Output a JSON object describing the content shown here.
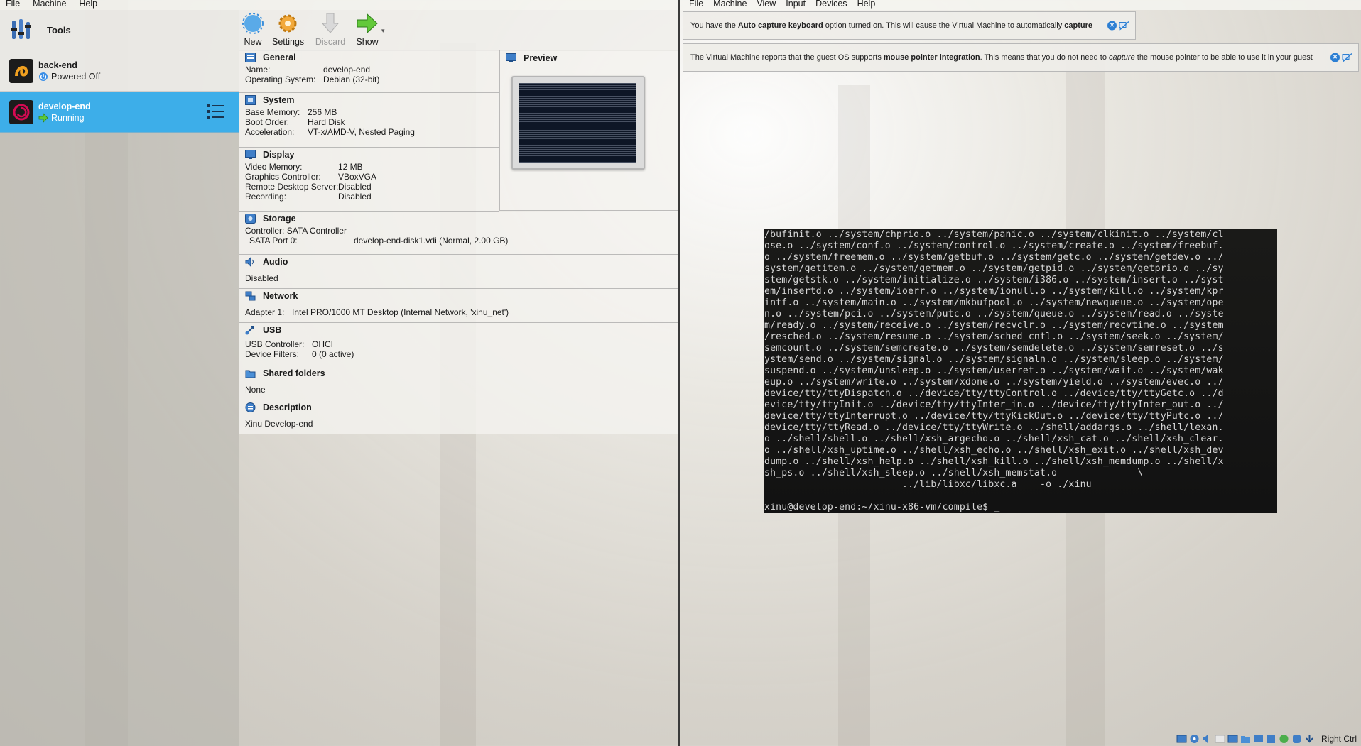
{
  "manager": {
    "menu": [
      "File",
      "Machine",
      "Help"
    ],
    "tools_label": "Tools",
    "vms": [
      {
        "name": "back-end",
        "state": "Powered Off"
      },
      {
        "name": "develop-end",
        "state": "Running"
      }
    ],
    "toolbar": {
      "new": "New",
      "settings": "Settings",
      "discard": "Discard",
      "show": "Show"
    },
    "general": {
      "title": "General",
      "name_label": "Name:",
      "name": "develop-end",
      "os_label": "Operating System:",
      "os": "Debian (32-bit)"
    },
    "system": {
      "title": "System",
      "mem_label": "Base Memory:",
      "mem": "256 MB",
      "boot_label": "Boot Order:",
      "boot": "Hard Disk",
      "accel_label": "Acceleration:",
      "accel": "VT-x/AMD-V, Nested Paging"
    },
    "preview_title": "Preview",
    "display": {
      "title": "Display",
      "vmem_label": "Video Memory:",
      "vmem": "12 MB",
      "gc_label": "Graphics Controller:",
      "gc": "VBoxVGA",
      "rds_label": "Remote Desktop Server:",
      "rds": "Disabled",
      "rec_label": "Recording:",
      "rec": "Disabled"
    },
    "storage": {
      "title": "Storage",
      "controller": "Controller: SATA Controller",
      "port_label": "SATA Port 0:",
      "port": "develop-end-disk1.vdi (Normal, 2.00 GB)"
    },
    "audio": {
      "title": "Audio",
      "value": "Disabled"
    },
    "network": {
      "title": "Network",
      "adapter_label": "Adapter 1:",
      "adapter": "Intel PRO/1000 MT Desktop (Internal Network, 'xinu_net')"
    },
    "usb": {
      "title": "USB",
      "ctrl_label": "USB Controller:",
      "ctrl": "OHCI",
      "filters_label": "Device Filters:",
      "filters": "0 (0 active)"
    },
    "shared": {
      "title": "Shared folders",
      "value": "None"
    },
    "description": {
      "title": "Description",
      "value": "Xinu Develop-end"
    }
  },
  "vmwindow": {
    "menu": [
      "File",
      "Machine",
      "View",
      "Input",
      "Devices",
      "Help"
    ],
    "notice1": {
      "pre": "You have the ",
      "bold1": "Auto capture keyboard",
      "mid": " option turned on. This will cause the Virtual Machine to automatically ",
      "bold2": "capture"
    },
    "notice2": {
      "pre": "The Virtual Machine reports that the guest OS supports ",
      "bold1": "mouse pointer integration",
      "mid": ". This means that you do not need to ",
      "ital": "capture",
      "post": " the mouse pointer to be able to use it in your guest"
    },
    "console_lines": [
      "/bufinit.o ../system/chprio.o ../system/panic.o ../system/clkinit.o ../system/cl",
      "ose.o ../system/conf.o ../system/control.o ../system/create.o ../system/freebuf.",
      "o ../system/freemem.o ../system/getbuf.o ../system/getc.o ../system/getdev.o ../",
      "system/getitem.o ../system/getmem.o ../system/getpid.o ../system/getprio.o ../sy",
      "stem/getstk.o ../system/initialize.o ../system/i386.o ../system/insert.o ../syst",
      "em/insertd.o ../system/ioerr.o ../system/ionull.o ../system/kill.o ../system/kpr",
      "intf.o ../system/main.o ../system/mkbufpool.o ../system/newqueue.o ../system/ope",
      "n.o ../system/pci.o ../system/putc.o ../system/queue.o ../system/read.o ../syste",
      "m/ready.o ../system/receive.o ../system/recvclr.o ../system/recvtime.o ../system",
      "/resched.o ../system/resume.o ../system/sched_cntl.o ../system/seek.o ../system/",
      "semcount.o ../system/semcreate.o ../system/semdelete.o ../system/semreset.o ../s",
      "ystem/send.o ../system/signal.o ../system/signaln.o ../system/sleep.o ../system/",
      "suspend.o ../system/unsleep.o ../system/userret.o ../system/wait.o ../system/wak",
      "eup.o ../system/write.o ../system/xdone.o ../system/yield.o ../system/evec.o ../",
      "device/tty/ttyDispatch.o ../device/tty/ttyControl.o ../device/tty/ttyGetc.o ../d",
      "evice/tty/ttyInit.o ../device/tty/ttyInter_in.o ../device/tty/ttyInter_out.o ../",
      "device/tty/ttyInterrupt.o ../device/tty/ttyKickOut.o ../device/tty/ttyPutc.o ../",
      "device/tty/ttyRead.o ../device/tty/ttyWrite.o ../shell/addargs.o ../shell/lexan.",
      "o ../shell/shell.o ../shell/xsh_argecho.o ../shell/xsh_cat.o ../shell/xsh_clear.",
      "o ../shell/xsh_uptime.o ../shell/xsh_echo.o ../shell/xsh_exit.o ../shell/xsh_dev",
      "dump.o ../shell/xsh_help.o ../shell/xsh_kill.o ../shell/xsh_memdump.o ../shell/x",
      "sh_ps.o ../shell/xsh_sleep.o ../shell/xsh_memstat.o              \\",
      "                        ../lib/libxc/libxc.a    -o ./xinu",
      "",
      "xinu@develop-end:~/xinu-x86-vm/compile$ _"
    ],
    "host_key": "Right Ctrl"
  }
}
